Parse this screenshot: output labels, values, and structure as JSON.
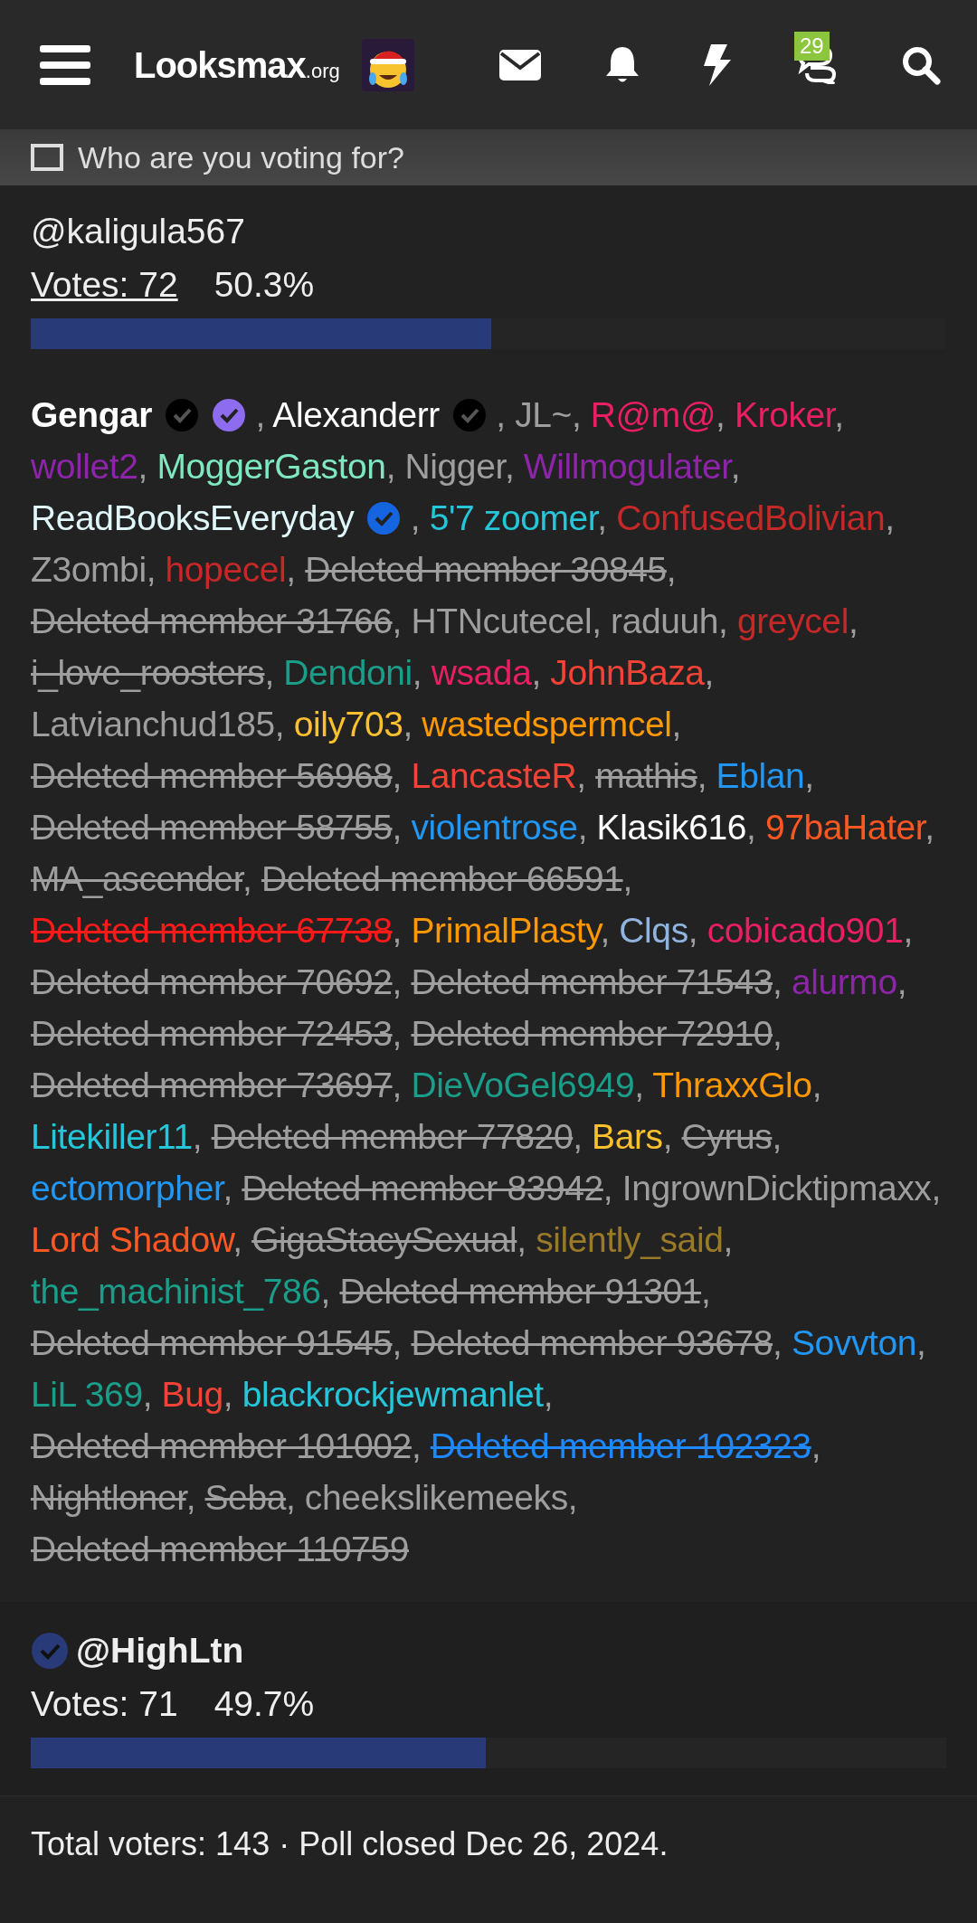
{
  "header": {
    "logo": "Looksmax",
    "logo_suffix": ".org",
    "alerts_badge": "29"
  },
  "poll": {
    "question": "Who are you voting for?",
    "separator": ",",
    "options": [
      {
        "name": "@kaligula567",
        "voted": false,
        "votes": "Votes: 72",
        "votes_underlined": true,
        "percent": "50.3%",
        "level": 0.503,
        "voters": [
          {
            "name": "Gengar",
            "color": "#ffffff",
            "bold": true,
            "deleted": false,
            "badges": [
              {
                "color": "#000000"
              },
              {
                "color": "#8e6cf0"
              }
            ]
          },
          {
            "name": "Alexanderr",
            "color": "#ffffff",
            "bold": false,
            "deleted": false,
            "badges": [
              {
                "color": "#000000"
              }
            ]
          },
          {
            "name": "JL~",
            "color": "#9e9e9e",
            "bold": false,
            "deleted": false
          },
          {
            "name": "R@m@",
            "color": "#e91e63",
            "bold": false,
            "deleted": false
          },
          {
            "name": "Kroker",
            "color": "#e91e63",
            "bold": false,
            "deleted": false
          },
          {
            "name": "wollet2",
            "color": "#8e24aa",
            "bold": false,
            "deleted": false
          },
          {
            "name": "MoggerGaston",
            "color": "#7ee8c0",
            "bold": false,
            "deleted": false
          },
          {
            "name": "Nigger",
            "color": "#9e9e9e",
            "bold": false,
            "deleted": false
          },
          {
            "name": "Willmogulater",
            "color": "#8e24aa",
            "bold": false,
            "deleted": false
          },
          {
            "name": "ReadBooksEveryday",
            "color": "#e0f7fa",
            "bold": false,
            "deleted": false,
            "badges": [
              {
                "color": "#1565e0"
              }
            ]
          },
          {
            "name": "5'7 zoomer",
            "color": "#26c6da",
            "bold": false,
            "deleted": false
          },
          {
            "name": "ConfusedBolivian",
            "color": "#c62828",
            "bold": false,
            "deleted": false
          },
          {
            "name": "Z3ombi",
            "color": "#9e9e9e",
            "bold": false,
            "deleted": false
          },
          {
            "name": "hopecel",
            "color": "#c62828",
            "bold": false,
            "deleted": false
          },
          {
            "name": "Deleted member 30845",
            "color": "#9e9e9e",
            "bold": false,
            "deleted": true
          },
          {
            "name": "Deleted member 31766",
            "color": "#9e9e9e",
            "bold": false,
            "deleted": true
          },
          {
            "name": "HTNcutecel",
            "color": "#9e9e9e",
            "bold": false,
            "deleted": false
          },
          {
            "name": "raduuh",
            "color": "#9e9e9e",
            "bold": false,
            "deleted": false
          },
          {
            "name": "greycel",
            "color": "#c62828",
            "bold": false,
            "deleted": false
          },
          {
            "name": "i_love_roosters",
            "color": "#9e9e9e",
            "bold": false,
            "deleted": true
          },
          {
            "name": "Dendoni",
            "color": "#1a9e8a",
            "bold": false,
            "deleted": false
          },
          {
            "name": "wsada",
            "color": "#e91e63",
            "bold": false,
            "deleted": false
          },
          {
            "name": "JohnBaza",
            "color": "#f44336",
            "bold": false,
            "deleted": false
          },
          {
            "name": "Latvianchud185",
            "color": "#9e9e9e",
            "bold": false,
            "deleted": false
          },
          {
            "name": "oily703",
            "color": "#fbc02d",
            "bold": false,
            "deleted": false
          },
          {
            "name": "wastedspermcel",
            "color": "#ff9800",
            "bold": false,
            "deleted": false
          },
          {
            "name": "Deleted member 56968",
            "color": "#9e9e9e",
            "bold": false,
            "deleted": true
          },
          {
            "name": "LancasteR",
            "color": "#f44336",
            "bold": false,
            "deleted": false
          },
          {
            "name": "mathis",
            "color": "#9e9e9e",
            "bold": false,
            "deleted": true
          },
          {
            "name": "Eblan",
            "color": "#2196f3",
            "bold": false,
            "deleted": false
          },
          {
            "name": "Deleted member 58755",
            "color": "#9e9e9e",
            "bold": false,
            "deleted": true
          },
          {
            "name": "violentrose",
            "color": "#2196f3",
            "bold": false,
            "deleted": false
          },
          {
            "name": "Klasik616",
            "color": "#ffffff",
            "bold": false,
            "deleted": false
          },
          {
            "name": "97baHater",
            "color": "#ff5722",
            "bold": false,
            "deleted": false
          },
          {
            "name": "MA_ascender",
            "color": "#9e9e9e",
            "bold": false,
            "deleted": true
          },
          {
            "name": "Deleted member 66591",
            "color": "#9e9e9e",
            "bold": false,
            "deleted": true
          },
          {
            "name": "Deleted member 67738",
            "color": "#ff1a1a",
            "bold": false,
            "deleted": true
          },
          {
            "name": "PrimalPlasty",
            "color": "#ff9800",
            "bold": false,
            "deleted": false
          },
          {
            "name": "Clqs",
            "color": "#90b4e0",
            "bold": false,
            "deleted": false
          },
          {
            "name": "cobicado901",
            "color": "#e91e63",
            "bold": false,
            "deleted": false
          },
          {
            "name": "Deleted member 70692",
            "color": "#9e9e9e",
            "bold": false,
            "deleted": true
          },
          {
            "name": "Deleted member 71543",
            "color": "#9e9e9e",
            "bold": false,
            "deleted": true
          },
          {
            "name": "alurmo",
            "color": "#8e24aa",
            "bold": false,
            "deleted": false
          },
          {
            "name": "Deleted member 72453",
            "color": "#9e9e9e",
            "bold": false,
            "deleted": true
          },
          {
            "name": "Deleted member 72910",
            "color": "#9e9e9e",
            "bold": false,
            "deleted": true
          },
          {
            "name": "Deleted member 73697",
            "color": "#9e9e9e",
            "bold": false,
            "deleted": true
          },
          {
            "name": "DieVoGel6949",
            "color": "#1a9e8a",
            "bold": false,
            "deleted": false
          },
          {
            "name": "ThraxxGlo",
            "color": "#ff9800",
            "bold": false,
            "deleted": false
          },
          {
            "name": "Litekiller11",
            "color": "#26c6da",
            "bold": false,
            "deleted": false
          },
          {
            "name": "Deleted member 77820",
            "color": "#9e9e9e",
            "bold": false,
            "deleted": true
          },
          {
            "name": "Bars",
            "color": "#fbc02d",
            "bold": false,
            "deleted": false
          },
          {
            "name": "Cyrus",
            "color": "#9e9e9e",
            "bold": false,
            "deleted": true
          },
          {
            "name": "ectomorpher",
            "color": "#2196f3",
            "bold": false,
            "deleted": false
          },
          {
            "name": "Deleted member 83942",
            "color": "#9e9e9e",
            "bold": false,
            "deleted": true
          },
          {
            "name": "IngrownDicktipmaxx",
            "color": "#9e9e9e",
            "bold": false,
            "deleted": false
          },
          {
            "name": "Lord Shadow",
            "color": "#ff5722",
            "bold": false,
            "deleted": false
          },
          {
            "name": "GigaStacySexual",
            "color": "#9e9e9e",
            "bold": false,
            "deleted": true
          },
          {
            "name": "silently_said",
            "color": "#9a7a28",
            "bold": false,
            "deleted": false
          },
          {
            "name": "the_machinist_786",
            "color": "#1a9e8a",
            "bold": false,
            "deleted": false
          },
          {
            "name": "Deleted member 91301",
            "color": "#9e9e9e",
            "bold": false,
            "deleted": true
          },
          {
            "name": "Deleted member 91545",
            "color": "#9e9e9e",
            "bold": false,
            "deleted": true
          },
          {
            "name": "Deleted member 93678",
            "color": "#9e9e9e",
            "bold": false,
            "deleted": true
          },
          {
            "name": "Sovvton",
            "color": "#2196f3",
            "bold": false,
            "deleted": false
          },
          {
            "name": "LiL 369",
            "color": "#1a9e8a",
            "bold": false,
            "deleted": false
          },
          {
            "name": "Bug",
            "color": "#f44336",
            "bold": false,
            "deleted": false
          },
          {
            "name": "blackrockjewmanlet",
            "color": "#26c6da",
            "bold": false,
            "deleted": false
          },
          {
            "name": "Deleted member 101002",
            "color": "#9e9e9e",
            "bold": false,
            "deleted": true
          },
          {
            "name": "Deleted member 102323",
            "color": "#1e88ff",
            "bold": false,
            "deleted": true
          },
          {
            "name": "Nightloner",
            "color": "#9e9e9e",
            "bold": false,
            "deleted": true
          },
          {
            "name": "Seba",
            "color": "#9e9e9e",
            "bold": false,
            "deleted": true
          },
          {
            "name": "cheekslikemeeks",
            "color": "#9e9e9e",
            "bold": false,
            "deleted": false
          },
          {
            "name": "Deleted member 110759",
            "color": "#9e9e9e",
            "bold": false,
            "deleted": true
          }
        ]
      },
      {
        "name": "@HighLtn",
        "voted": true,
        "votes": "Votes: 71",
        "votes_underlined": false,
        "percent": "49.7%",
        "level": 0.497
      }
    ],
    "footer": "Total voters: 143 · Poll closed Dec 26, 2024."
  }
}
